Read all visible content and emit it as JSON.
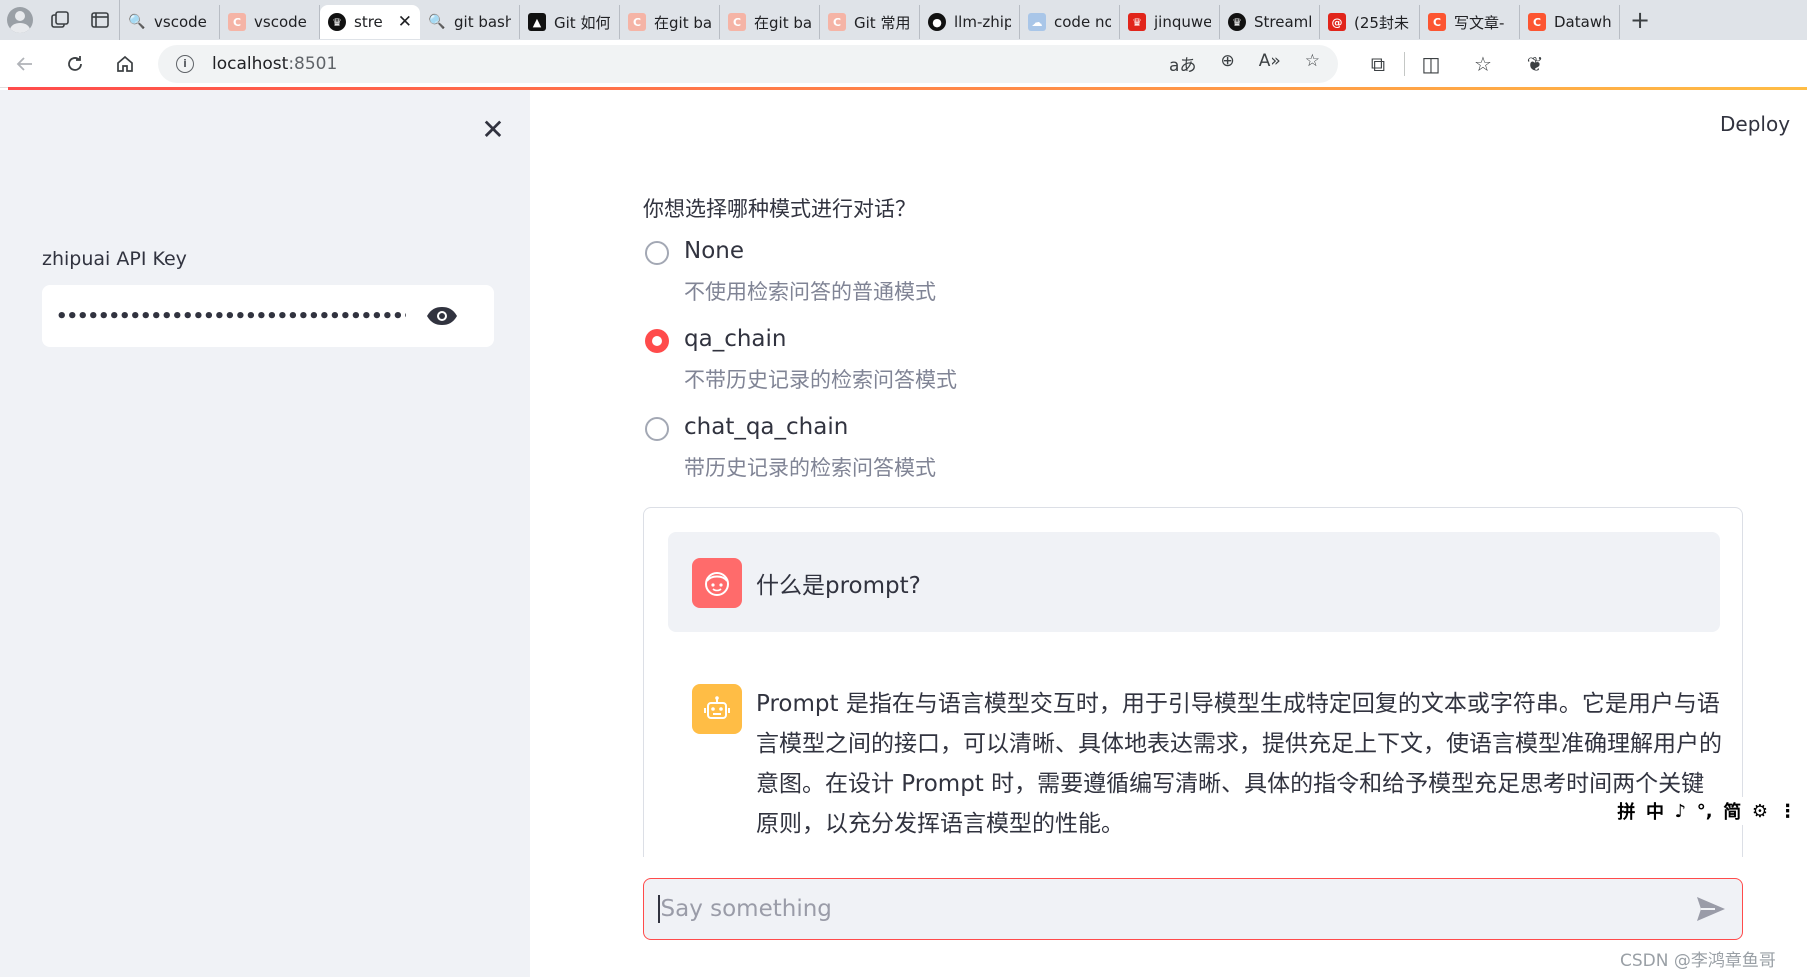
{
  "browser": {
    "tabs": [
      {
        "title": "vscode",
        "icon": "search-icon"
      },
      {
        "title": "vscode",
        "icon": "csdn-icon"
      },
      {
        "title": "stre",
        "icon": "streamlit-icon",
        "active": true
      },
      {
        "title": "git bash",
        "icon": "search-icon"
      },
      {
        "title": "Git 如何",
        "icon": "cap-icon"
      },
      {
        "title": "在git ba",
        "icon": "csdn-icon"
      },
      {
        "title": "在git ba",
        "icon": "csdn-icon"
      },
      {
        "title": "Git 常用",
        "icon": "csdn-icon"
      },
      {
        "title": "llm-zhip",
        "icon": "github-icon"
      },
      {
        "title": "code no",
        "icon": "cloud-icon"
      },
      {
        "title": "jinquwe",
        "icon": "crown-icon"
      },
      {
        "title": "Streaml",
        "icon": "streamlit-icon"
      },
      {
        "title": "(25封未",
        "icon": "mail-icon"
      },
      {
        "title": "写文章-",
        "icon": "csdn-icon"
      },
      {
        "title": "Datawh",
        "icon": "csdn-icon"
      }
    ],
    "url_host": "localhost",
    "url_port": ":8501"
  },
  "sidebar": {
    "api_key_label": "zhipuai API Key",
    "api_key_masked": "•••••••••••••••••••••••••••••••••••••••••••••••"
  },
  "main": {
    "deploy_label": "Deploy",
    "mode_question": "你想选择哪种模式进行对话？",
    "options": [
      {
        "label": "None",
        "desc": "不使用检索问答的普通模式",
        "checked": false
      },
      {
        "label": "qa_chain",
        "desc": "不带历史记录的检索问答模式",
        "checked": true
      },
      {
        "label": "chat_qa_chain",
        "desc": "带历史记录的检索问答模式",
        "checked": false
      }
    ],
    "messages": {
      "user": "什么是prompt?",
      "assistant": "Prompt 是指在与语言模型交互时，用于引导模型生成特定回复的文本或字符串。它是用户与语言模型之间的接口，可以清晰、具体地表达需求，提供充足上下文，使语言模型准确理解用户的意图。在设计 Prompt 时，需要遵循编写清晰、具体的指令和给予模型充足思考时间两个关键原则，以充分发挥语言模型的性能。"
    },
    "chat_placeholder": "Say something"
  },
  "ime": {
    "items": [
      "拼",
      "中",
      "♪",
      "°,",
      "简",
      "⚙",
      "⋮"
    ]
  },
  "watermark": "CSDN @李鸿章鱼哥",
  "colors": {
    "accent": "#ff4b4b",
    "sidebar_bg": "#f0f2f6",
    "user_avatar": "#ff6b6b",
    "bot_avatar": "#ffbd45"
  }
}
